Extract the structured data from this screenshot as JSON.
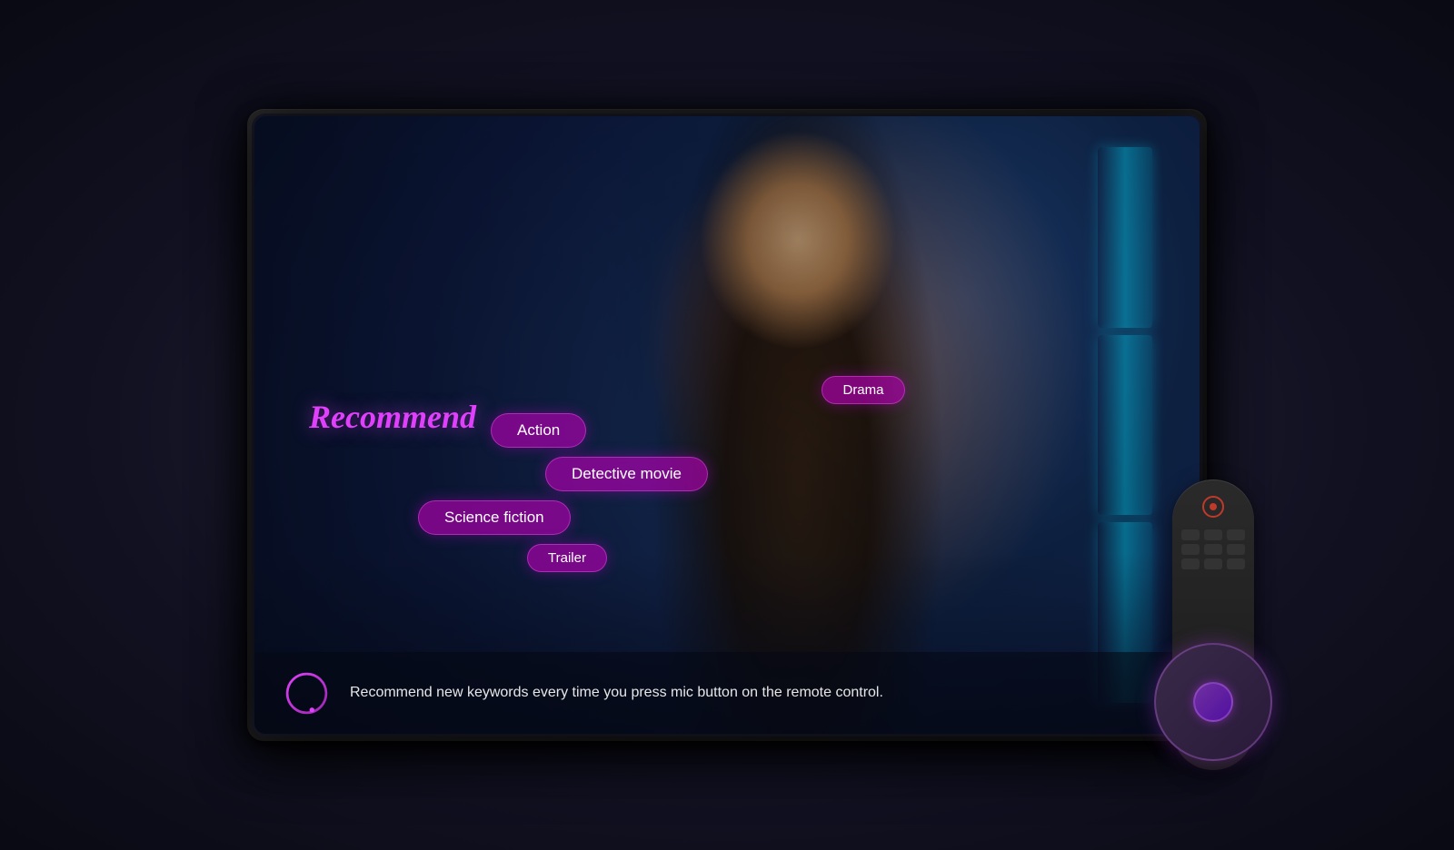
{
  "tv": {
    "recommend_label": "Recommend",
    "genres": [
      {
        "id": "drama",
        "label": "Drama",
        "row": 1
      },
      {
        "id": "action",
        "label": "Action",
        "row": 2
      },
      {
        "id": "detective_movie",
        "label": "Detective movie",
        "row": 3
      },
      {
        "id": "science_fiction",
        "label": "Science fiction",
        "row": 4
      },
      {
        "id": "trailer",
        "label": "Trailer",
        "row": 5
      }
    ],
    "bottom_text": "Recommend new keywords every time you press mic button on the remote control.",
    "voice_icon": "voice-icon"
  },
  "colors": {
    "accent": "#e040fb",
    "bubble_bg": "rgba(180,0,180,0.65)",
    "text_white": "#ffffff"
  }
}
